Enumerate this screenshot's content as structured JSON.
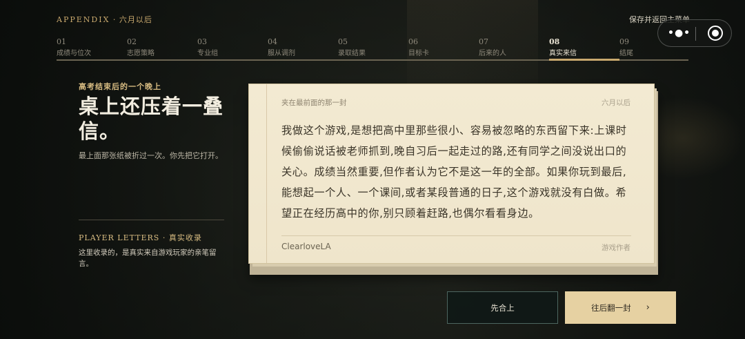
{
  "header": {
    "appendix_label": "APPENDIX",
    "appendix_sep": " · ",
    "appendix_sub": "六月以后",
    "save_link": "保存并返回主菜单"
  },
  "capsule": {
    "more_icon": "more-dots-icon",
    "close_icon": "target-circle-icon"
  },
  "steps": [
    {
      "num": "01",
      "label": "成绩与位次"
    },
    {
      "num": "02",
      "label": "志愿策略"
    },
    {
      "num": "03",
      "label": "专业组"
    },
    {
      "num": "04",
      "label": "服从调剂"
    },
    {
      "num": "05",
      "label": "录取结果"
    },
    {
      "num": "06",
      "label": "目标卡"
    },
    {
      "num": "07",
      "label": "后来的人"
    },
    {
      "num": "08",
      "label": "真实来信"
    },
    {
      "num": "09",
      "label": "结尾"
    }
  ],
  "active_step": "08",
  "left": {
    "kicker": "高考结束后的一个晚上",
    "title": "桌上还压着一叠信。",
    "desc": "最上面那张纸被折过一次。你先把它打开。",
    "player_letters_title": "PLAYER LETTERS",
    "player_letters_sep": " · ",
    "player_letters_sub": "真实收录",
    "player_letters_desc": "这里收录的，是真实来自游戏玩家的亲笔留言。"
  },
  "letter": {
    "header_left": "夹在最前面的那一封",
    "header_right": "六月以后",
    "body": "我做这个游戏,是想把高中里那些很小、容易被忽略的东西留下来:上课时候偷偷说话被老师抓到,晚自习后一起走过的路,还有同学之间没说出口的关心。成绩当然重要,但作者认为它不是这一年的全部。如果你玩到最后,能想起一个人、一个课间,或者某段普通的日子,这个游戏就没有白做。希望正在经历高中的你,别只顾着赶路,也偶尔看看身边。",
    "signature": "ClearloveLA",
    "signature_role": "游戏作者"
  },
  "buttons": {
    "close_label": "先合上",
    "next_label": "往后翻一封",
    "next_icon": "chevron-right-icon"
  },
  "colors": {
    "accent_gold": "#c9a96e",
    "paper": "#f3ead2",
    "button_primary": "#e6d1a2"
  }
}
